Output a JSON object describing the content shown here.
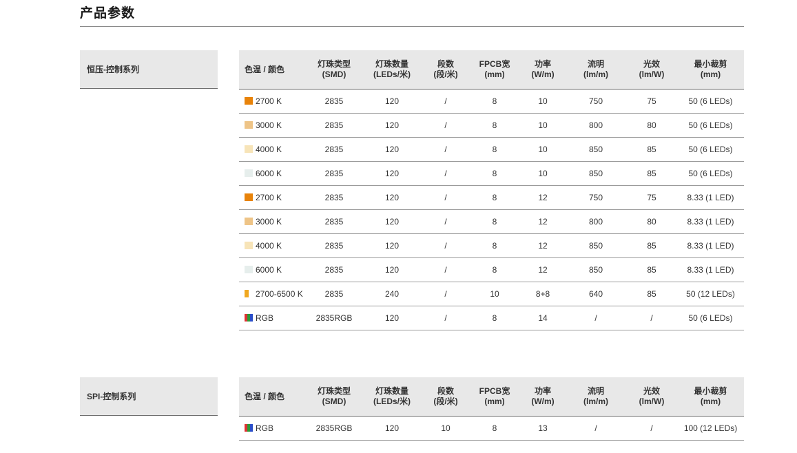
{
  "page_title": "产品参数",
  "columns": [
    "色温 / 颜色",
    "灯珠类型\n(SMD)",
    "灯珠数量\n(LEDs/米)",
    "段数\n(段/米)",
    "FPCB宽\n(mm)",
    "功率\n(W/m)",
    "流明\n(lm/m)",
    "光效\n(lm/W)",
    "最小裁剪\n(mm)"
  ],
  "sections": [
    {
      "label": "恒压-控制系列",
      "rows": [
        {
          "color": "2700 K",
          "swatch": "#e8830a",
          "smd": "2835",
          "leds": "120",
          "segments": "/",
          "fpcb": "8",
          "power": "10",
          "lumen": "750",
          "efficacy": "75",
          "cut": "50 (6 LEDs)"
        },
        {
          "color": "3000 K",
          "swatch": "#eec487",
          "smd": "2835",
          "leds": "120",
          "segments": "/",
          "fpcb": "8",
          "power": "10",
          "lumen": "800",
          "efficacy": "80",
          "cut": "50 (6 LEDs)"
        },
        {
          "color": "4000 K",
          "swatch": "#f7e4b8",
          "smd": "2835",
          "leds": "120",
          "segments": "/",
          "fpcb": "8",
          "power": "10",
          "lumen": "850",
          "efficacy": "85",
          "cut": "50 (6 LEDs)"
        },
        {
          "color": "6000 K",
          "swatch": "#e6eeec",
          "smd": "2835",
          "leds": "120",
          "segments": "/",
          "fpcb": "8",
          "power": "10",
          "lumen": "850",
          "efficacy": "85",
          "cut": "50 (6 LEDs)"
        },
        {
          "color": "2700 K",
          "swatch": "#e8830a",
          "smd": "2835",
          "leds": "120",
          "segments": "/",
          "fpcb": "8",
          "power": "12",
          "lumen": "750",
          "efficacy": "75",
          "cut": "8.33 (1 LED)"
        },
        {
          "color": "3000 K",
          "swatch": "#eec487",
          "smd": "2835",
          "leds": "120",
          "segments": "/",
          "fpcb": "8",
          "power": "12",
          "lumen": "800",
          "efficacy": "80",
          "cut": "8.33 (1 LED)"
        },
        {
          "color": "4000 K",
          "swatch": "#f7e4b8",
          "smd": "2835",
          "leds": "120",
          "segments": "/",
          "fpcb": "8",
          "power": "12",
          "lumen": "850",
          "efficacy": "85",
          "cut": "8.33 (1 LED)"
        },
        {
          "color": "6000 K",
          "swatch": "#e6eeec",
          "smd": "2835",
          "leds": "120",
          "segments": "/",
          "fpcb": "8",
          "power": "12",
          "lumen": "850",
          "efficacy": "85",
          "cut": "8.33 (1 LED)"
        },
        {
          "color": "2700-6500 K",
          "swatch": "#f0a820",
          "swatch_style": "thin",
          "smd": "2835",
          "leds": "240",
          "segments": "/",
          "fpcb": "10",
          "power": "8+8",
          "lumen": "640",
          "efficacy": "85",
          "cut": "50 (12 LEDs)"
        },
        {
          "color": "RGB",
          "swatch": "rgb",
          "smd": "2835RGB",
          "leds": "120",
          "segments": "/",
          "fpcb": "8",
          "power": "14",
          "lumen": "/",
          "efficacy": "/",
          "cut": "50 (6 LEDs)"
        }
      ]
    },
    {
      "label": "SPI-控制系列",
      "rows": [
        {
          "color": "RGB",
          "swatch": "rgb",
          "smd": "2835RGB",
          "leds": "120",
          "segments": "10",
          "fpcb": "8",
          "power": "13",
          "lumen": "/",
          "efficacy": "/",
          "cut": "100 (12 LEDs)"
        }
      ]
    }
  ]
}
